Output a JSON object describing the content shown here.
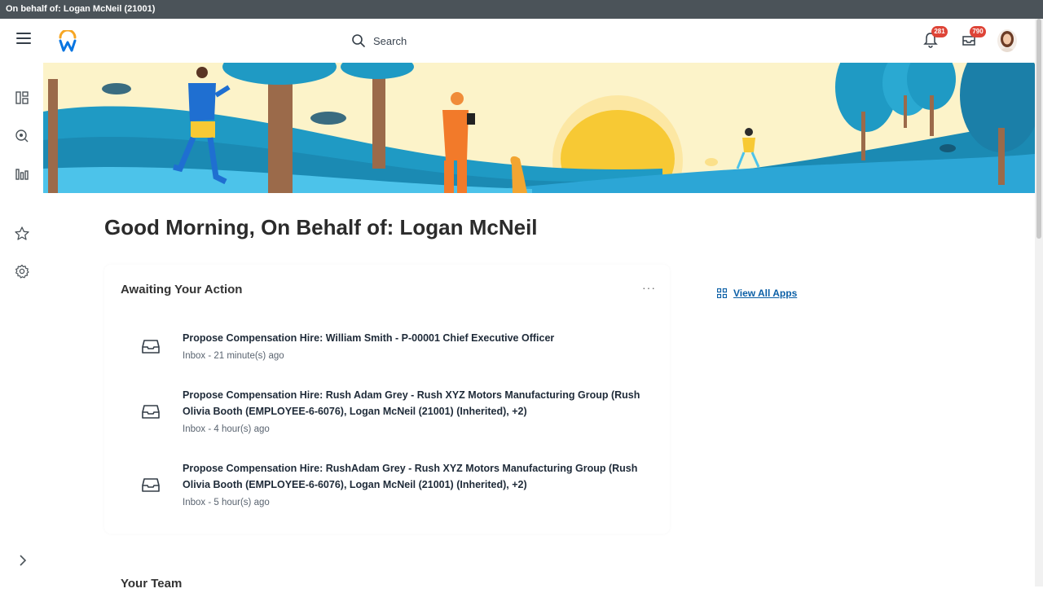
{
  "topbar": {
    "text": "On behalf of: Logan McNeil (21001)"
  },
  "header": {
    "search_placeholder": "Search",
    "notifications_count": "281",
    "inbox_count": "790"
  },
  "greeting": "Good Morning, On Behalf of: Logan McNeil",
  "awaiting": {
    "title": "Awaiting Your Action",
    "more": "···",
    "items": [
      {
        "title": "Propose Compensation Hire: William Smith - P-00001 Chief Executive Officer",
        "sub": "Inbox - 21 minute(s) ago"
      },
      {
        "title": "Propose Compensation Hire: Rush Adam Grey - Rush XYZ Motors Manufacturing Group (Rush Olivia Booth (EMPLOYEE-6-6076), Logan McNeil (21001) (Inherited), +2)",
        "sub": "Inbox - 4 hour(s) ago"
      },
      {
        "title": "Propose Compensation Hire: RushAdam Grey - Rush XYZ Motors Manufacturing Group (Rush Olivia Booth (EMPLOYEE-6-6076), Logan McNeil (21001) (Inherited), +2)",
        "sub": "Inbox - 5 hour(s) ago"
      }
    ]
  },
  "apps": {
    "view_all_label": "View All Apps"
  },
  "team": {
    "title": "Your Team"
  },
  "colors": {
    "topbar": "#4b5359",
    "link": "#0b5fa6",
    "badge": "#de4437",
    "logo_blue": "#0875e1",
    "logo_orange": "#f6a623"
  }
}
